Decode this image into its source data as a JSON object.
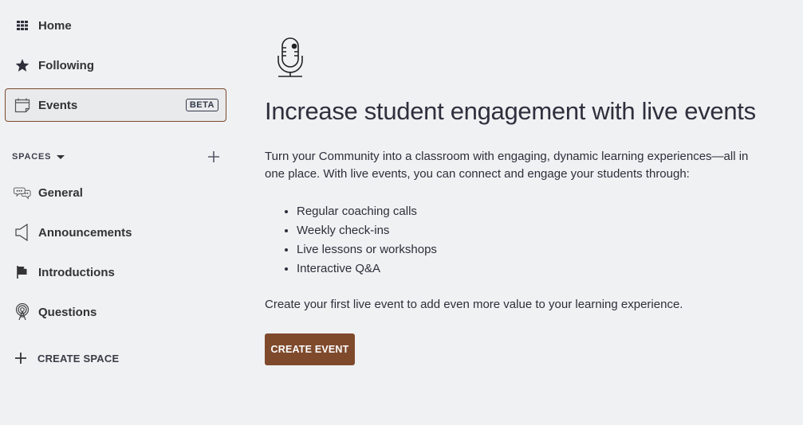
{
  "sidebar": {
    "items": [
      {
        "label": "Home",
        "icon": "grid-icon"
      },
      {
        "label": "Following",
        "icon": "star-icon"
      },
      {
        "label": "Events",
        "icon": "calendar-icon",
        "badge": "BETA",
        "active": true
      }
    ],
    "spaces_header": "SPACES",
    "spaces": [
      {
        "label": "General",
        "icon": "chat-bubbles-icon"
      },
      {
        "label": "Announcements",
        "icon": "megaphone-icon"
      },
      {
        "label": "Introductions",
        "icon": "flag-icon"
      },
      {
        "label": "Questions",
        "icon": "broadcast-tower-icon"
      }
    ],
    "create_space_label": "CREATE SPACE"
  },
  "main": {
    "icon": "microphone-icon",
    "headline": "Increase student engagement with live events",
    "intro": "Turn your Community into a classroom with engaging, dynamic learning experiences—all in one place. With live events, you can connect and engage your students through:",
    "bullets": [
      "Regular coaching calls",
      "Weekly check-ins",
      "Live lessons or workshops",
      "Interactive Q&A"
    ],
    "outro": "Create your first live event to add even more value to your learning experience.",
    "cta_label": "CREATE EVENT"
  },
  "colors": {
    "accent": "#7f4a2c",
    "background": "#f0f1f3",
    "text": "#2d2e3a"
  }
}
